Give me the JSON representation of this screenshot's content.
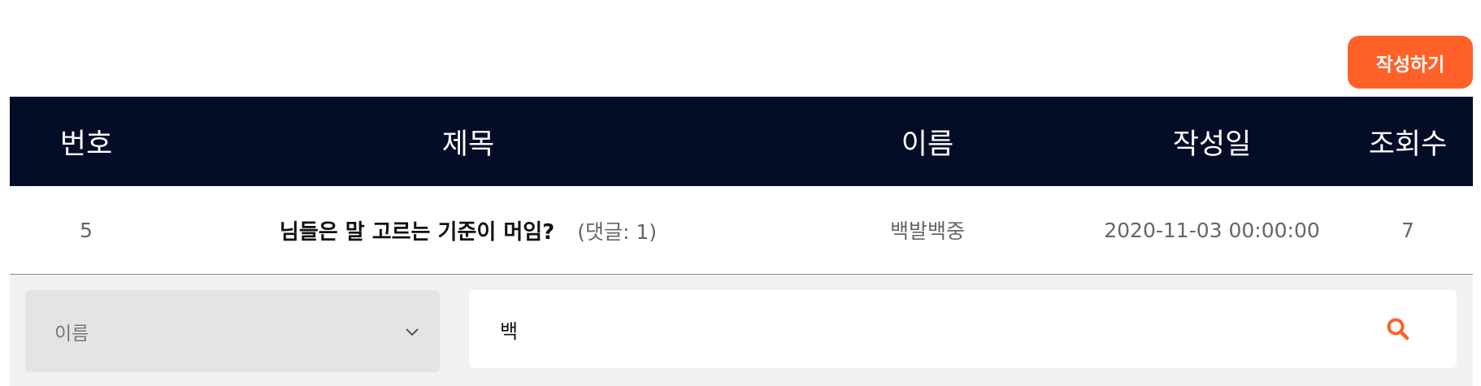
{
  "toolbar": {
    "write_label": "작성하기"
  },
  "table": {
    "columns": {
      "no": "번호",
      "title": "제목",
      "name": "이름",
      "date": "작성일",
      "views": "조회수"
    },
    "rows": [
      {
        "no": "5",
        "title": "님들은 말 고르는 기준이 머임?",
        "comments": "(댓글: 1)",
        "name": "백발백중",
        "date": "2020-11-03 00:00:00",
        "views": "7"
      }
    ]
  },
  "search": {
    "field_selected": "이름",
    "query": "백"
  },
  "colors": {
    "accent": "#ff6129",
    "header_bg": "#040d27"
  },
  "icons": {
    "select_arrow": "chevron-down-icon",
    "search": "search-icon"
  }
}
